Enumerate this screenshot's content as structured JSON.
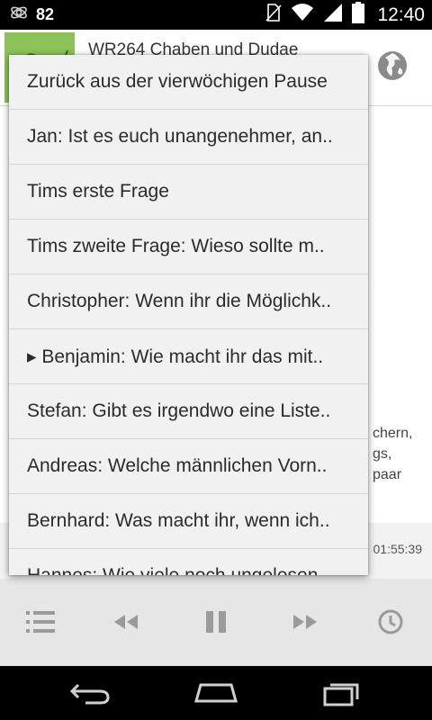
{
  "status_bar": {
    "battery_level": "82",
    "time": "12:40",
    "icons": [
      "podcast-notification-icon",
      "no-sim-icon",
      "wifi-icon",
      "signal-icon",
      "battery-icon"
    ]
  },
  "header": {
    "podcast_title": "WR264 Chaben und Dudae"
  },
  "chapters": [
    {
      "label": "Zurück aus der vierwöchigen Pause"
    },
    {
      "label": "Jan: Ist es euch unangenehmer, an.."
    },
    {
      "label": "Tims erste Frage"
    },
    {
      "label": "Tims zweite Frage: Wieso sollte m.."
    },
    {
      "label": "Christopher: Wenn ihr die Möglichk.."
    },
    {
      "label": "▸ Benjamin: Wie macht ihr das mit.."
    },
    {
      "label": "Stefan: Gibt es irgendwo eine Liste.."
    },
    {
      "label": "Andreas: Welche männlichen Vorn.."
    },
    {
      "label": "Bernhard: Was macht ihr, wenn ich.."
    },
    {
      "label": "Hannes: Wie viele noch ungelesen.."
    }
  ],
  "background_text": {
    "lines": [
      "chern,",
      "gs,",
      "paar"
    ]
  },
  "player": {
    "time_remaining": "01:55:39"
  },
  "colors": {
    "status_bar": "#000000",
    "menu_background": "#f1f1f1",
    "controls_background": "#e6e6e6",
    "icon_gray": "#9a9a9a",
    "cover_green": "#8dc25a"
  }
}
